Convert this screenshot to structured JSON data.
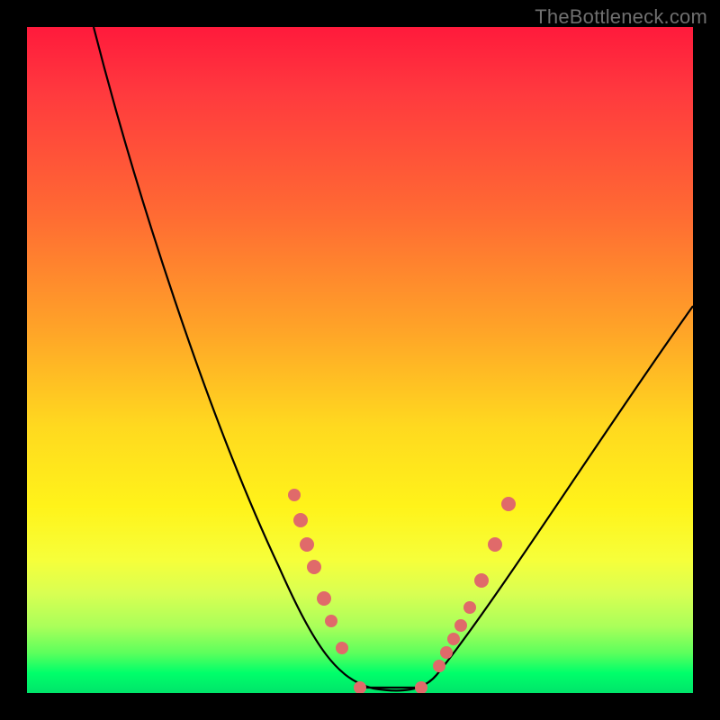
{
  "attribution": "TheBottleneck.com",
  "colors": {
    "frame": "#000000",
    "gradient_stops": [
      "#ff1a3c",
      "#ff3a3e",
      "#ff6a33",
      "#ffa228",
      "#ffd91f",
      "#fff31a",
      "#f6ff3a",
      "#d9ff52",
      "#aaff5a",
      "#5cff5c",
      "#00ff6a",
      "#00e46a"
    ],
    "curve": "#000000",
    "markers": "#e06a6a"
  },
  "chart_data": {
    "type": "line",
    "title": "",
    "xlabel": "",
    "ylabel": "",
    "xlim": [
      0,
      100
    ],
    "ylim": [
      0,
      100
    ],
    "grid": false,
    "legend": false,
    "annotations": [
      "TheBottleneck.com"
    ],
    "series": [
      {
        "name": "bottleneck-curve",
        "x": [
          10,
          14,
          18,
          22,
          26,
          30,
          33,
          36,
          38,
          40,
          42,
          44,
          46,
          48,
          50,
          52,
          54,
          56,
          58,
          60,
          63,
          66,
          70,
          75,
          80,
          85,
          90,
          95,
          100
        ],
        "y": [
          100,
          91,
          82,
          73,
          64,
          55,
          47,
          40,
          35,
          30,
          25,
          20,
          15,
          10,
          6,
          3,
          1,
          0,
          0,
          0,
          2,
          6,
          12,
          20,
          28,
          36,
          44,
          52,
          59
        ]
      }
    ],
    "markers_left": [
      {
        "x": 40,
        "y": 30
      },
      {
        "x": 41,
        "y": 26
      },
      {
        "x": 42,
        "y": 23
      },
      {
        "x": 43,
        "y": 20
      },
      {
        "x": 45,
        "y": 15
      },
      {
        "x": 46,
        "y": 12
      },
      {
        "x": 48,
        "y": 8
      }
    ],
    "markers_right": [
      {
        "x": 62,
        "y": 3
      },
      {
        "x": 63,
        "y": 5
      },
      {
        "x": 64,
        "y": 7
      },
      {
        "x": 65,
        "y": 9
      },
      {
        "x": 66,
        "y": 12
      },
      {
        "x": 68,
        "y": 17
      },
      {
        "x": 70,
        "y": 23
      },
      {
        "x": 72,
        "y": 29
      }
    ],
    "floor_segment": {
      "x_start": 50,
      "x_end": 59,
      "y": 0
    }
  }
}
